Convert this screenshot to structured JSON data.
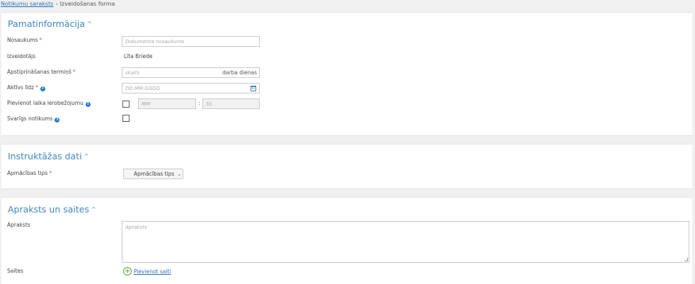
{
  "breadcrumb": {
    "link": "Notikumu saraksts",
    "separator": "›",
    "current": "Izveidošanas forma"
  },
  "section_basic": {
    "title": "Pamatinformācija",
    "name_label": "Nosaukums",
    "name_placeholder": "Dokumenta nosaukums",
    "creator_label": "Izveidotājs",
    "creator_value": "Līta Briede",
    "deadline_label": "Apstiprināšanas termiņš",
    "deadline_placeholder": "skaits",
    "deadline_suffix": "darba dienas",
    "active_label": "Aktīvs līdz",
    "active_placeholder": "DD.MM.GGGG",
    "time_limit_label": "Pievienot laika ierobežojumu",
    "minutes_placeholder": "MM",
    "seconds_placeholder": "SS",
    "time_separator": ":",
    "important_label": "Svarīgs notikums",
    "required_mark": "*",
    "info_glyph": "i"
  },
  "section_instruction": {
    "title": "Instruktāžas dati",
    "type_label": "Apmācības tips",
    "type_value": "Apmācības tips",
    "required_mark": "*"
  },
  "section_description": {
    "title": "Apraksts un saites",
    "desc_label": "Apraksts",
    "desc_placeholder": "Apraksts",
    "links_label": "Saites",
    "add_link": "Pievienot saiti"
  },
  "icons": {
    "chevron_up": "^",
    "chevron_down": "⌄",
    "plus": "+"
  },
  "colors": {
    "accent": "#3f86c6",
    "link": "#2a6ebb",
    "required": "#d9534f",
    "info": "#1c7ed6",
    "add": "#5aa02c"
  }
}
